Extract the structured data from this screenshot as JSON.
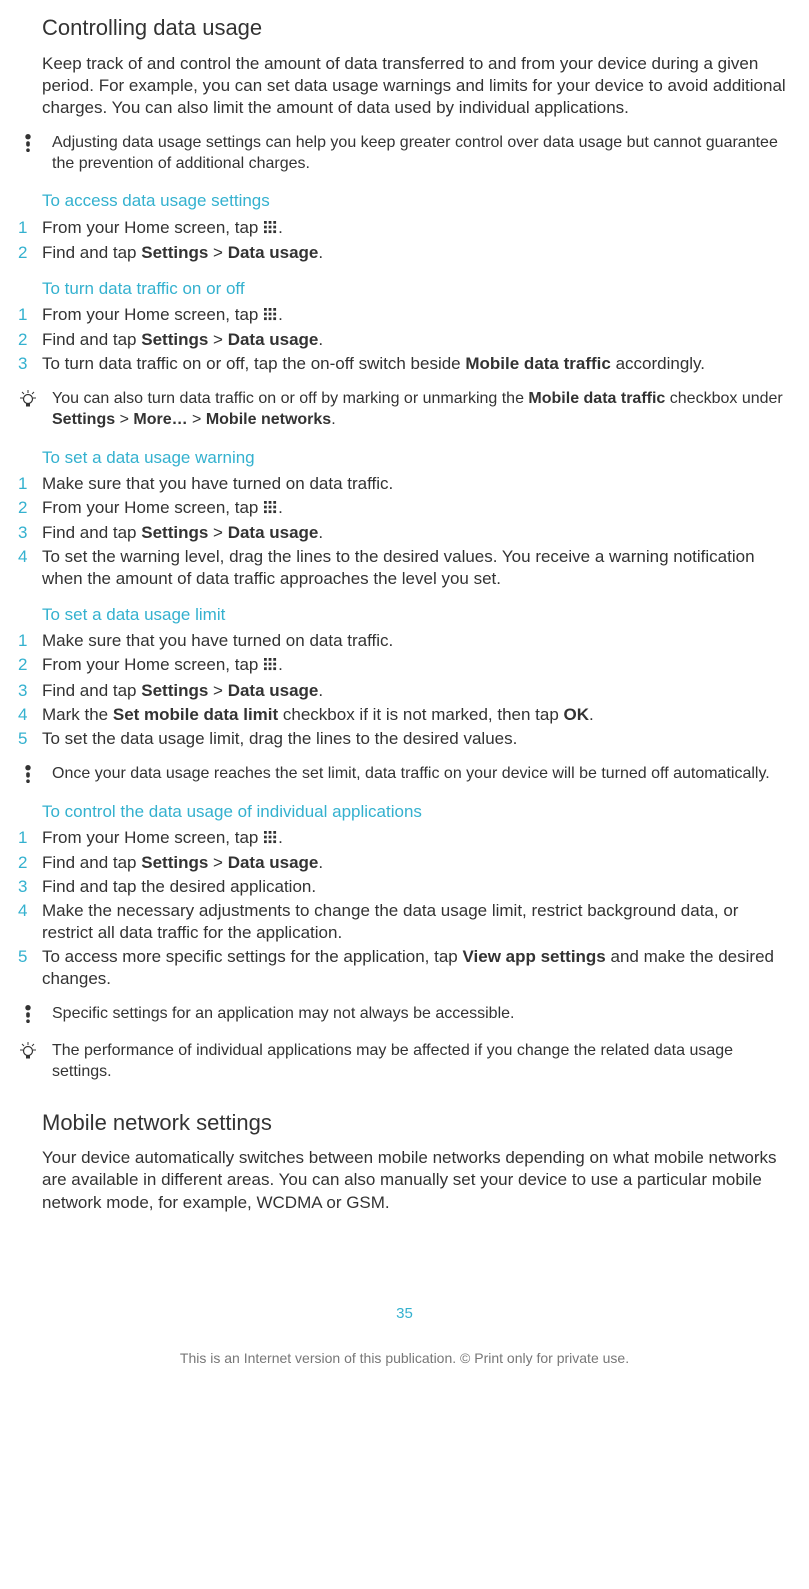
{
  "section1": {
    "title": "Controlling data usage",
    "intro": "Keep track of and control the amount of data transferred to and from your device during a given period. For example, you can set data usage warnings and limits for your device to avoid additional charges. You can also limit the amount of data used by individual applications.",
    "note1": "Adjusting data usage settings can help you keep greater control over data usage but cannot guarantee the prevention of additional charges."
  },
  "proc1": {
    "title": "To access data usage settings",
    "s1a": "From your Home screen, tap ",
    "s1b": ".",
    "s2a": "Find and tap ",
    "s2_settings": "Settings",
    "s2_gt": " > ",
    "s2_data": "Data usage",
    "s2b": "."
  },
  "proc2": {
    "title": "To turn data traffic on or off",
    "s1a": "From your Home screen, tap ",
    "s1b": ".",
    "s2a": "Find and tap ",
    "s2_settings": "Settings",
    "s2_gt": " > ",
    "s2_data": "Data usage",
    "s2b": ".",
    "s3a": "To turn data traffic on or off, tap the on-off switch beside ",
    "s3_bold": "Mobile data traffic",
    "s3b": " accordingly.",
    "tip_a": "You can also turn data traffic on or off by marking or unmarking the ",
    "tip_b1": "Mobile data traffic",
    "tip_c": " checkbox under ",
    "tip_b2": "Settings",
    "tip_gt1": " > ",
    "tip_b3": "More…",
    "tip_gt2": " > ",
    "tip_b4": "Mobile networks",
    "tip_d": "."
  },
  "proc3": {
    "title": "To set a data usage warning",
    "s1": "Make sure that you have turned on data traffic.",
    "s2a": "From your Home screen, tap ",
    "s2b": ".",
    "s3a": "Find and tap ",
    "s3_settings": "Settings",
    "s3_gt": " > ",
    "s3_data": "Data usage",
    "s3b": ".",
    "s4": "To set the warning level, drag the lines to the desired values. You receive a warning notification when the amount of data traffic approaches the level you set."
  },
  "proc4": {
    "title": "To set a data usage limit",
    "s1": "Make sure that you have turned on data traffic.",
    "s2a": "From your Home screen, tap ",
    "s2b": ".",
    "s3a": "Find and tap ",
    "s3_settings": "Settings",
    "s3_gt": " > ",
    "s3_data": "Data usage",
    "s3b": ".",
    "s4a": "Mark the ",
    "s4_b1": "Set mobile data limit",
    "s4b": " checkbox if it is not marked, then tap ",
    "s4_b2": "OK",
    "s4c": ".",
    "s5": "To set the data usage limit, drag the lines to the desired values.",
    "note": "Once your data usage reaches the set limit, data traffic on your device will be turned off automatically."
  },
  "proc5": {
    "title": "To control the data usage of individual applications",
    "s1a": "From your Home screen, tap ",
    "s1b": ".",
    "s2a": "Find and tap ",
    "s2_settings": "Settings",
    "s2_gt": " > ",
    "s2_data": "Data usage",
    "s2b": ".",
    "s3": "Find and tap the desired application.",
    "s4": "Make the necessary adjustments to change the data usage limit, restrict background data, or restrict all data traffic for the application.",
    "s5a": "To access more specific settings for the application, tap ",
    "s5_b": "View app settings",
    "s5b": " and make the desired changes.",
    "note": "Specific settings for an application may not always be accessible.",
    "tip": "The performance of individual applications may be affected if you change the related data usage settings."
  },
  "section2": {
    "title": "Mobile network settings",
    "intro": "Your device automatically switches between mobile networks depending on what mobile networks are available in different areas. You can also manually set your device to use a particular mobile network mode, for example, WCDMA or GSM."
  },
  "footer": {
    "page": "35",
    "line": "This is an Internet version of this publication. © Print only for private use."
  }
}
